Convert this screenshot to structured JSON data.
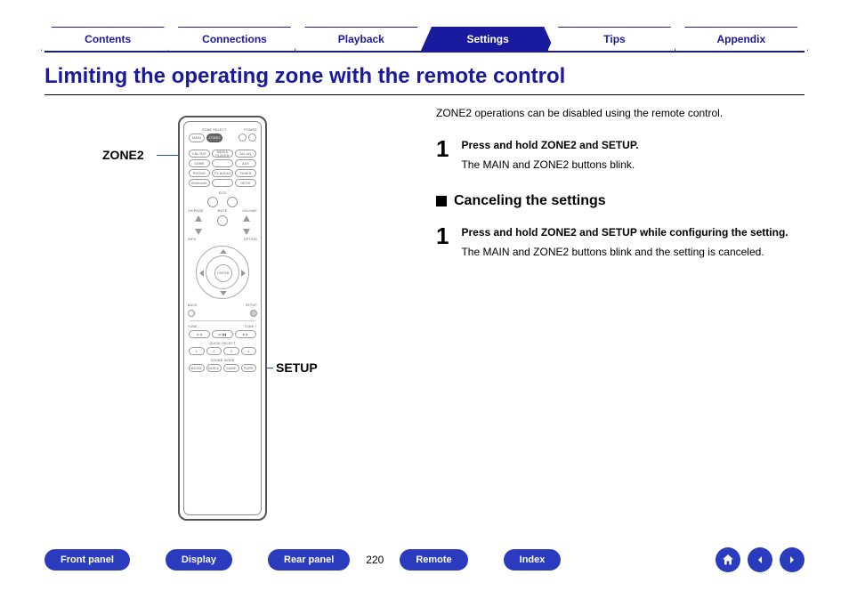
{
  "topnav": {
    "tabs": [
      "Contents",
      "Connections",
      "Playback",
      "Settings",
      "Tips",
      "Appendix"
    ],
    "active_index": 3
  },
  "heading": "Limiting the operating zone with the remote control",
  "diagram": {
    "label_zone2": "ZONE2",
    "label_setup": "SETUP",
    "remote_labels": {
      "zone_select": "ZONE SELECT",
      "power": "POWER",
      "main": "MAIN",
      "zone2": "ZONE2",
      "cbl_sat": "CBL/SAT",
      "media_player": "MEDIA PLAYER",
      "blu_ray": "Blu-ray",
      "game": "GAME",
      "aux": "AUX",
      "phono": "PHONO",
      "tv_audio": "TV AUDIO",
      "tuner": "TUNER",
      "bluetooth": "Bluetooth",
      "heos": "HEOS",
      "eco": "ECO",
      "ch_page": "CH/PAGE",
      "mute": "MUTE",
      "volume": "VOLUME",
      "info": "INFO",
      "option": "OPTION",
      "enter": "ENTER",
      "back": "BACK",
      "setup": "SETUP",
      "tune_minus": "TUNE -",
      "tune_plus": "TUNE +",
      "quick_select": "QUICK SELECT",
      "qs": [
        "1",
        "2",
        "3",
        "4"
      ],
      "sound_mode": "SOUND MODE",
      "sm": [
        "MOVIE",
        "MUSIC",
        "GAME",
        "PURE"
      ]
    }
  },
  "content": {
    "intro": "ZONE2 operations can be disabled using the remote control.",
    "steps1": [
      {
        "num": "1",
        "title": "Press and hold ZONE2 and SETUP.",
        "body": "The MAIN and ZONE2 buttons blink."
      }
    ],
    "subhead": "Canceling the settings",
    "steps2": [
      {
        "num": "1",
        "title": "Press and hold ZONE2 and SETUP while configuring the setting.",
        "body": "The MAIN and ZONE2 buttons blink and the setting is canceled."
      }
    ]
  },
  "bottomnav": {
    "buttons": [
      "Front panel",
      "Display",
      "Rear panel"
    ],
    "page": "220",
    "buttons2": [
      "Remote",
      "Index"
    ],
    "icons": [
      "home-icon",
      "prev-icon",
      "next-icon"
    ]
  }
}
